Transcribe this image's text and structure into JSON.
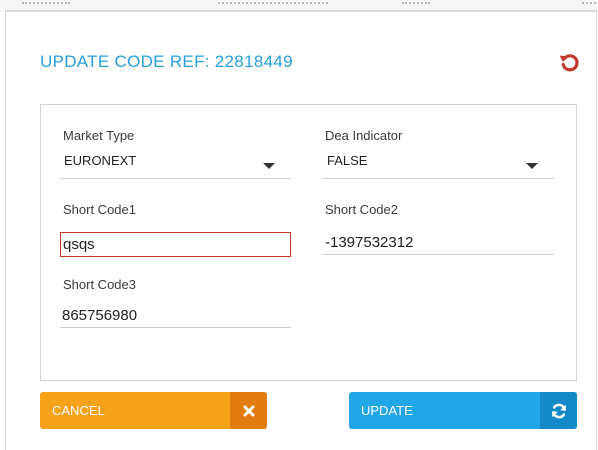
{
  "dialog": {
    "title": "UPDATE CODE REF: 22818449"
  },
  "form": {
    "market_type": {
      "label": "Market Type",
      "value": "EURONEXT"
    },
    "dea_indicator": {
      "label": "Dea Indicator",
      "value": "FALSE"
    },
    "short_code1": {
      "label": "Short Code1",
      "value": "qsqs"
    },
    "short_code2": {
      "label": "Short Code2",
      "value": "-1397532312"
    },
    "short_code3": {
      "label": "Short Code3",
      "value": "865756980"
    }
  },
  "buttons": {
    "cancel_label": "CANCEL",
    "update_label": "UPDATE"
  },
  "colors": {
    "title": "#2aa0da",
    "reset_icon": "#c0392b",
    "cancel": "#f7a21b",
    "cancel_icon_bg": "#e07c10",
    "update": "#21a7e7",
    "update_icon_bg": "#1489c8",
    "invalid_border": "#c0392b"
  },
  "icons": {
    "reset": "undo-icon",
    "cancel": "close-icon",
    "update": "refresh-icon",
    "dropdown": "caret-down-icon"
  }
}
